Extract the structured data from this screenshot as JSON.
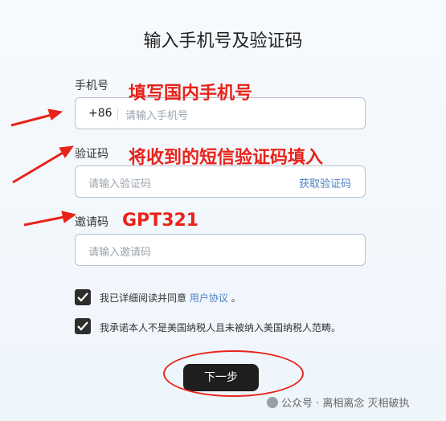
{
  "title": "输入手机号及验证码",
  "phone": {
    "label": "手机号",
    "country_code": "+86",
    "placeholder": "请输入手机号"
  },
  "code": {
    "label": "验证码",
    "placeholder": "请输入验证码",
    "get_code_label": "获取验证码"
  },
  "invite": {
    "label": "邀请码",
    "placeholder": "请输入邀请码"
  },
  "agreement": {
    "text": "我已详细阅读并同意",
    "link": "用户协议",
    "suffix": "。"
  },
  "tax_statement": {
    "text": "我承诺本人不是美国纳税人且未被纳入美国纳税人范畴。"
  },
  "next_button": "下一步",
  "annotations": {
    "phone": "填写国内手机号",
    "code": "将收到的短信验证码填入",
    "invite": "GPT321"
  },
  "watermark": "公众号 · 离相离念 灭相破执",
  "colors": {
    "annotation": "#e8231a",
    "link": "#4e7fc4",
    "button": "#1e1e1e"
  }
}
